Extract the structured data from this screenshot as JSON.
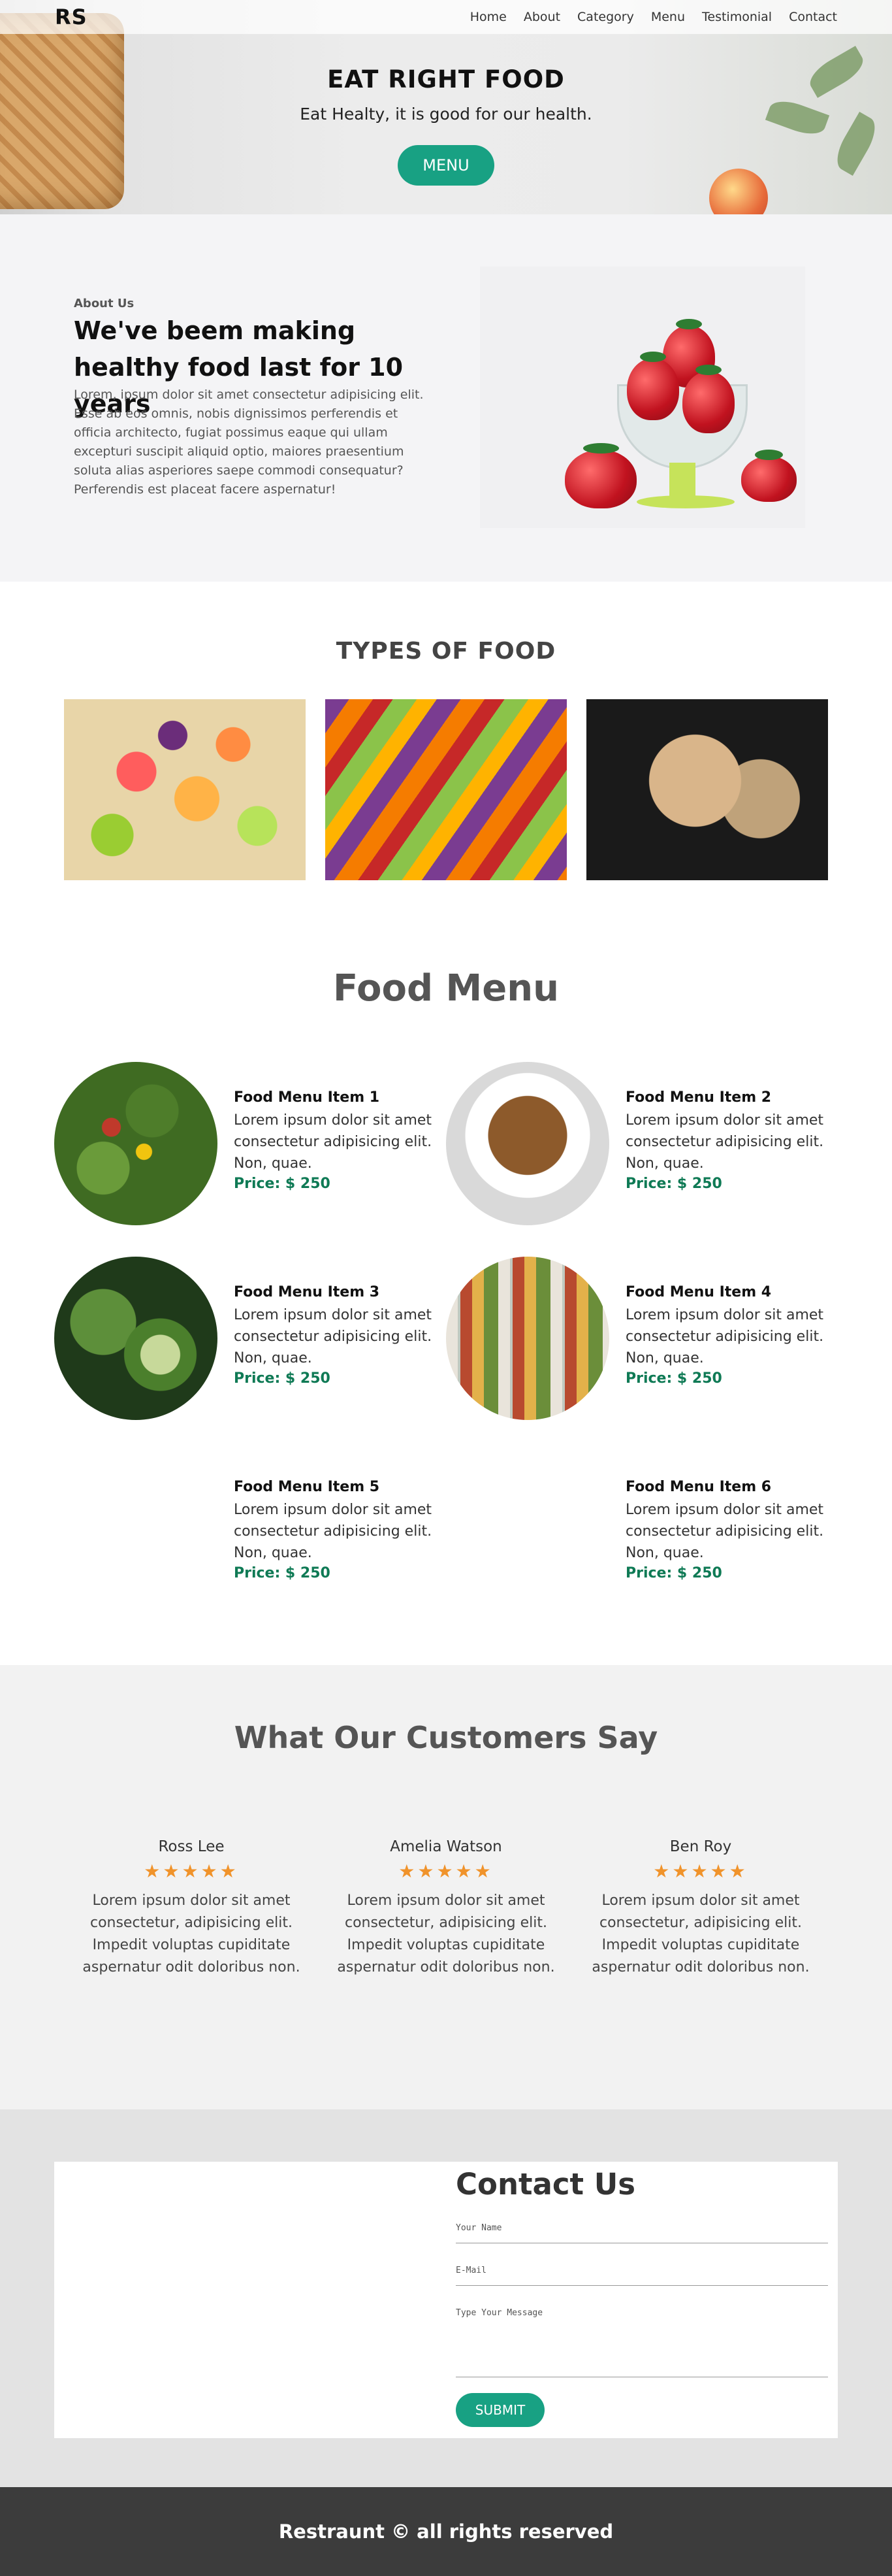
{
  "nav": {
    "logo": "RS",
    "links": [
      "Home",
      "About",
      "Category",
      "Menu",
      "Testimonial",
      "Contact"
    ]
  },
  "hero": {
    "title": "EAT RIGHT FOOD",
    "subtitle": "Eat Healty, it is good for our health.",
    "button": "MENU"
  },
  "about": {
    "label": "About Us",
    "title": "We've beem making healthy food last for 10 years",
    "body": "Lorem, ipsum dolor sit amet consectetur adipisicing elit. Esse ab eos omnis, nobis dignissimos perferendis et officia architecto, fugiat possimus eaque qui ullam excepturi suscipit aliquid optio, maiores praesentium soluta alias asperiores saepe commodi consequatur? Perferendis est placeat facere aspernatur!"
  },
  "types": {
    "title": "TYPES OF FOOD"
  },
  "menu": {
    "title": "Food Menu",
    "items": [
      {
        "name": "Food Menu Item 1",
        "desc": "Lorem ipsum dolor sit amet consectetur adipisicing elit. Non, quae.",
        "price": "Price: $ 250"
      },
      {
        "name": "Food Menu Item 2",
        "desc": "Lorem ipsum dolor sit amet consectetur adipisicing elit. Non, quae.",
        "price": "Price: $ 250"
      },
      {
        "name": "Food Menu Item 3",
        "desc": "Lorem ipsum dolor sit amet consectetur adipisicing elit. Non, quae.",
        "price": "Price: $ 250"
      },
      {
        "name": "Food Menu Item 4",
        "desc": "Lorem ipsum dolor sit amet consectetur adipisicing elit. Non, quae.",
        "price": "Price: $ 250"
      },
      {
        "name": "Food Menu Item 5",
        "desc": "Lorem ipsum dolor sit amet consectetur adipisicing elit. Non, quae.",
        "price": "Price: $ 250"
      },
      {
        "name": "Food Menu Item 6",
        "desc": "Lorem ipsum dolor sit amet consectetur adipisicing elit. Non, quae.",
        "price": "Price: $ 250"
      }
    ]
  },
  "testimonials": {
    "title": "What Our Customers Say",
    "items": [
      {
        "name": "Ross Lee",
        "stars": "★★★★★",
        "text": "Lorem ipsum dolor sit amet consectetur, adipisicing elit. Impedit voluptas cupiditate aspernatur odit doloribus non."
      },
      {
        "name": "Amelia Watson",
        "stars": "★★★★★",
        "text": "Lorem ipsum dolor sit amet consectetur, adipisicing elit. Impedit voluptas cupiditate aspernatur odit doloribus non."
      },
      {
        "name": "Ben Roy",
        "stars": "★★★★★",
        "text": "Lorem ipsum dolor sit amet consectetur, adipisicing elit. Impedit voluptas cupiditate aspernatur odit doloribus non."
      }
    ]
  },
  "contact": {
    "title": "Contact Us",
    "name_label": "Your Name",
    "email_label": "E-Mail",
    "message_label": "Type Your Message",
    "submit": "SUBMIT"
  },
  "footer": {
    "text": "Restraunt © all rights reserved"
  },
  "colors": {
    "accent": "#18a183",
    "price": "#0f7a55",
    "star": "#f0932b",
    "footer_bg": "#3c3c3c"
  }
}
